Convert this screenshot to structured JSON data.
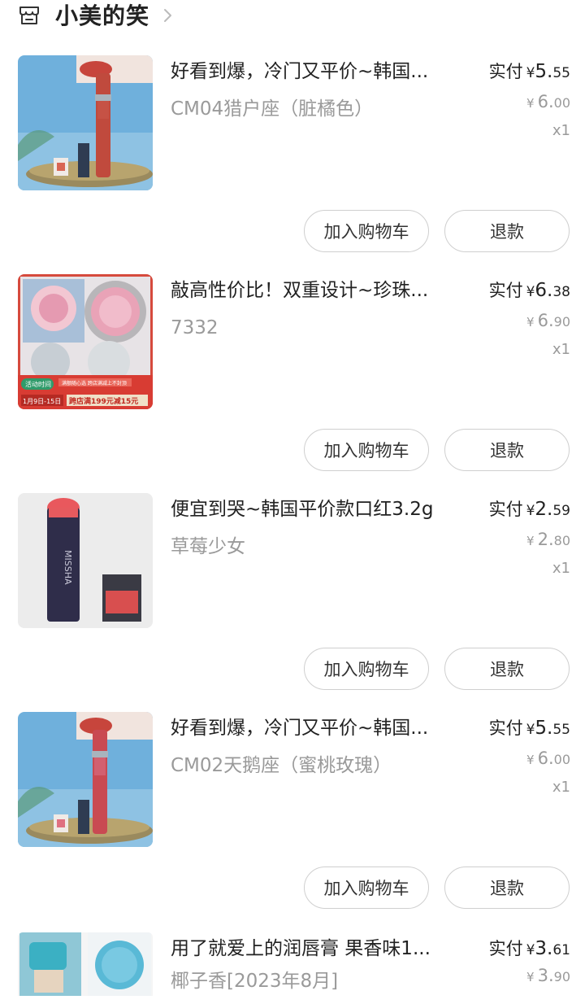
{
  "store": {
    "name": "小美的笑",
    "icon": "store-icon"
  },
  "orders": [
    {
      "title": "好看到爆，冷门又平价~韩国...",
      "spec": "CM04猎户座（脏橘色）",
      "paid_label": "实付",
      "paid_currency": "¥",
      "paid_int": "5.",
      "paid_dec": "55",
      "orig_currency": "¥",
      "orig_int": "6.",
      "orig_dec": "00",
      "qty": "x1",
      "cart_label": "加入购物车",
      "refund_label": "退款"
    },
    {
      "title": "敲高性价比！双重设计~珍珠...",
      "spec": "7332",
      "paid_label": "实付",
      "paid_currency": "¥",
      "paid_int": "6.",
      "paid_dec": "38",
      "orig_currency": "¥",
      "orig_int": "6.",
      "orig_dec": "90",
      "qty": "x1",
      "cart_label": "加入购物车",
      "refund_label": "退款",
      "thumb_text": {
        "badge": "活动时间",
        "dates": "1月9日-15日",
        "promo": "跨店满199元减15元",
        "sub": "满额随心选 跨店满减上不封顶"
      }
    },
    {
      "title": "便宜到哭~韩国平价款口红3.2g",
      "spec": "草莓少女",
      "paid_label": "实付",
      "paid_currency": "¥",
      "paid_int": "2.",
      "paid_dec": "59",
      "orig_currency": "¥",
      "orig_int": "2.",
      "orig_dec": "80",
      "qty": "x1",
      "cart_label": "加入购物车",
      "refund_label": "退款",
      "thumb_text": {
        "brand": "MISSHA"
      }
    },
    {
      "title": "好看到爆，冷门又平价~韩国...",
      "spec": "CM02天鹅座（蜜桃玫瑰）",
      "paid_label": "实付",
      "paid_currency": "¥",
      "paid_int": "5.",
      "paid_dec": "55",
      "orig_currency": "¥",
      "orig_int": "6.",
      "orig_dec": "00",
      "qty": "x1",
      "cart_label": "加入购物车",
      "refund_label": "退款"
    },
    {
      "title": "用了就爱上的润唇膏 果香味1...",
      "spec": "椰子香[2023年8月]",
      "paid_label": "实付",
      "paid_currency": "¥",
      "paid_int": "3.",
      "paid_dec": "61",
      "orig_currency": "¥",
      "orig_int": "3.",
      "orig_dec": "90"
    }
  ],
  "colors": {
    "text": "#222222",
    "muted": "#9a9a9a",
    "border": "#cfcfcf"
  }
}
